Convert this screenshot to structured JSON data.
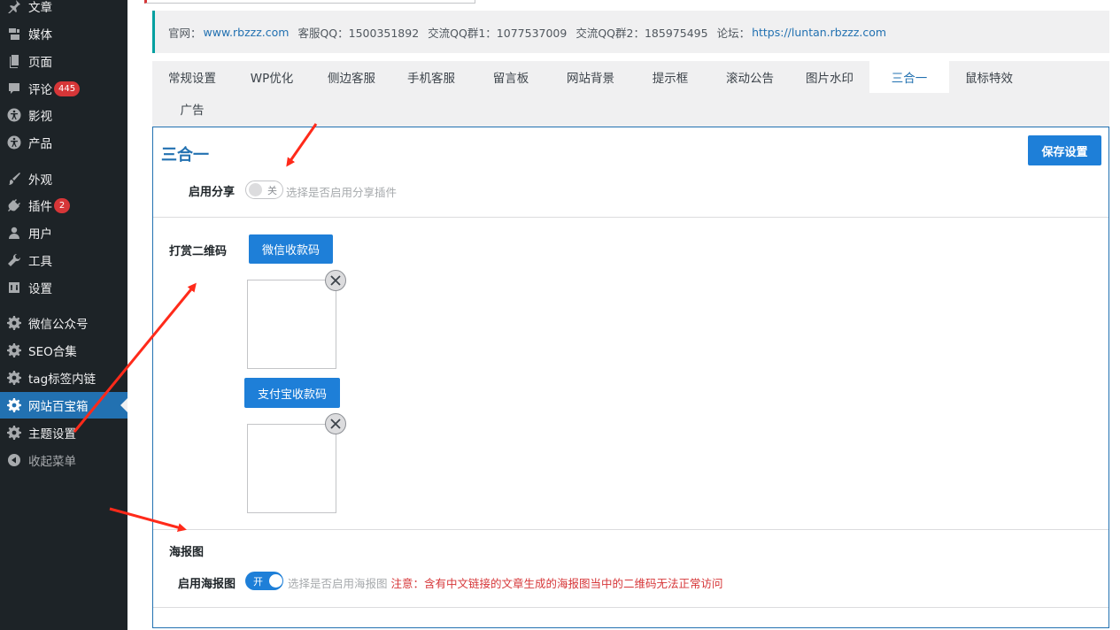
{
  "sidebar": {
    "items": [
      {
        "label": "文章",
        "icon": "pin-icon"
      },
      {
        "label": "媒体",
        "icon": "media-icon"
      },
      {
        "label": "页面",
        "icon": "page-icon"
      },
      {
        "label": "评论",
        "icon": "comment-icon",
        "badge": "445"
      },
      {
        "label": "影视",
        "icon": "accessibility-icon"
      },
      {
        "label": "产品",
        "icon": "accessibility-icon"
      },
      {
        "label": "外观",
        "icon": "brush-icon"
      },
      {
        "label": "插件",
        "icon": "plugin-icon",
        "badge": "2"
      },
      {
        "label": "用户",
        "icon": "user-icon"
      },
      {
        "label": "工具",
        "icon": "wrench-icon"
      },
      {
        "label": "设置",
        "icon": "settings-icon"
      },
      {
        "label": "微信公众号",
        "icon": "gear-icon"
      },
      {
        "label": "SEO合集",
        "icon": "gear-icon"
      },
      {
        "label": "tag标签内链",
        "icon": "gear-icon"
      },
      {
        "label": "网站百宝箱",
        "icon": "gear-icon",
        "active": true
      },
      {
        "label": "主题设置",
        "icon": "gear-icon"
      },
      {
        "label": "收起菜单",
        "icon": "collapse-icon"
      }
    ]
  },
  "notice": {
    "site_label": "官网：",
    "site_link": "www.rbzzz.com",
    "qq_label": "客服QQ：1500351892",
    "group1": "交流QQ群1：1077537009",
    "group2": "交流QQ群2：185975495",
    "forum_label": "论坛：",
    "forum_link": "https://luntan.rbzzz.com"
  },
  "tabs": [
    "常规设置",
    "WP优化",
    "侧边客服",
    "手机客服",
    "留言板",
    "网站背景",
    "提示框",
    "滚动公告",
    "图片水印",
    "三合一",
    "鼠标特效",
    "广告"
  ],
  "active_tab": "三合一",
  "panel": {
    "title": "三合一",
    "save_button": "保存设置",
    "share": {
      "label": "启用分享",
      "toggle_text": "关",
      "hint": "选择是否启用分享插件"
    },
    "reward": {
      "label": "打赏二维码",
      "wechat_button": "微信收款码",
      "alipay_button": "支付宝收款码"
    },
    "poster": {
      "section_label": "海报图",
      "label": "启用海报图",
      "toggle_text": "开",
      "hint": "选择是否启用海报图",
      "warning": "注意：含有中文链接的文章生成的海报图当中的二维码无法正常访问"
    }
  },
  "colors": {
    "sidebar_bg": "#1d2327",
    "accent": "#2271b1",
    "button": "#1e7fd8",
    "badge": "#d63638",
    "annotation_arrow": "#ff2a1a"
  }
}
